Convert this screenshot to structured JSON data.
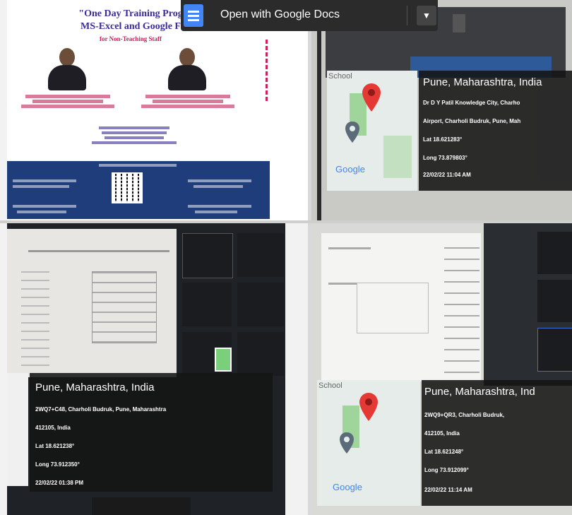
{
  "toolbar": {
    "open_label": "Open with Google Docs",
    "dropdown_icon": "chevron-down-icon",
    "app_icon": "google-docs-icon"
  },
  "flyer": {
    "title_line1": "\"One Day Training Prog",
    "title_line2": "MS-Excel and Google F",
    "title_line3": "for Non-Teaching Staff"
  },
  "cards": {
    "top_right": {
      "place": "Pune, Maharashtra, India",
      "lines": [
        "Dr D Y Patil Knowledge City, Charho",
        "Airport, Charholi Budruk, Pune, Mah",
        "Lat 18.621283°",
        "Long 73.879803°",
        "22/02/22 11:04 AM"
      ]
    },
    "bottom_left": {
      "place": "Pune, Maharashtra, India",
      "lines": [
        "2WQ7+C48, Charholi Budruk, Pune, Maharashtra",
        "412105, India",
        "Lat 18.621238°",
        "Long 73.912350°",
        "22/02/22 01:38 PM"
      ]
    },
    "bottom_right": {
      "place": "Pune, Maharashtra, Ind",
      "lines": [
        "2WQ9+QR3, Charholi Budruk,",
        "412105, India",
        "Lat 18.621248°",
        "Long 73.912099°",
        "22/02/22 11:14 AM"
      ]
    }
  },
  "map": {
    "school_label": "School",
    "google_label": "Google"
  },
  "colors": {
    "accent_purple": "#7a1bf0",
    "docs_blue": "#4285f4",
    "flyer_navy": "#1e3d7a",
    "pin_red": "#e53935"
  }
}
